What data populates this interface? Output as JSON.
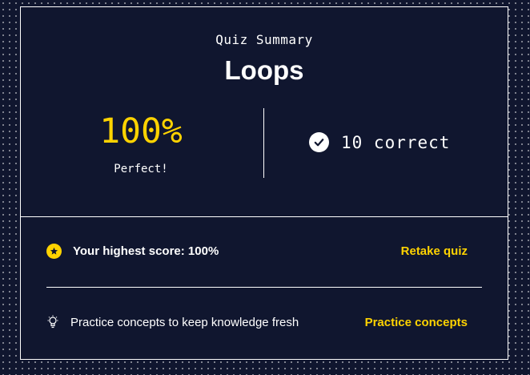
{
  "summary": {
    "eyebrow": "Quiz Summary",
    "title": "Loops",
    "score": "100%",
    "score_label": "Perfect!",
    "correct_text": "10 correct"
  },
  "highest": {
    "text": "Your highest score: 100%",
    "action": "Retake quiz"
  },
  "practice": {
    "text": "Practice concepts to keep knowledge fresh",
    "action": "Practice concepts"
  },
  "colors": {
    "background": "#10162f",
    "accent": "#ffd300",
    "text": "#ffffff"
  },
  "icons": [
    "check-circle-icon",
    "star-icon",
    "lightbulb-icon"
  ]
}
